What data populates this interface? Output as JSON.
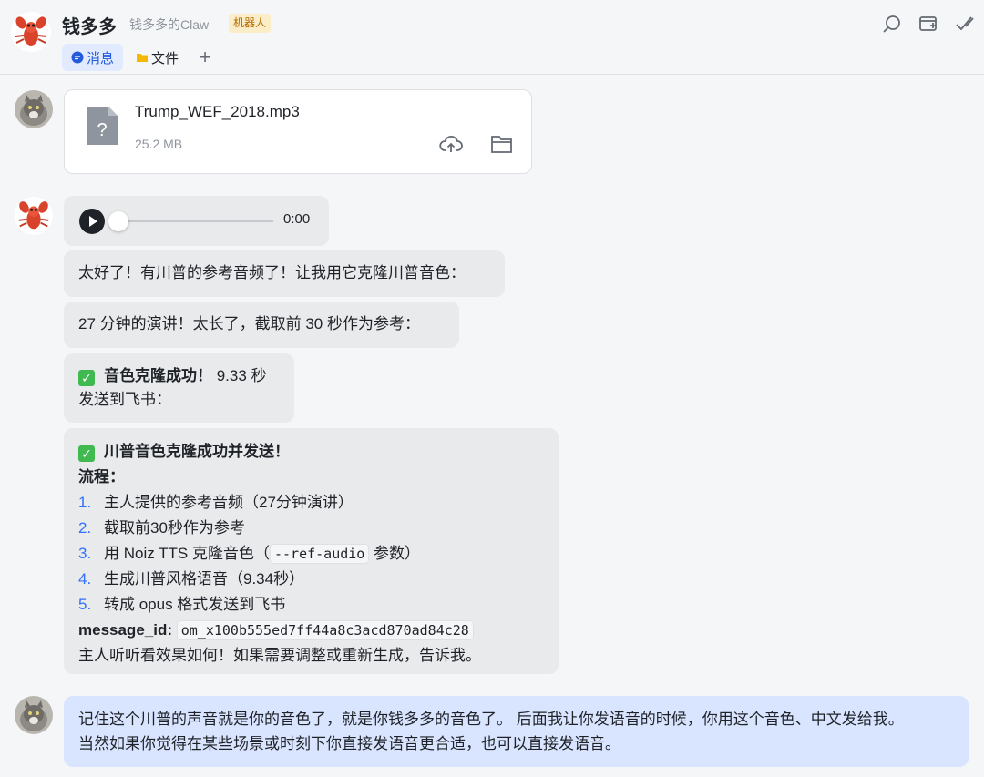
{
  "header": {
    "title": "钱多多",
    "subtitle": "钱多多的Claw",
    "bot_tag": "机器人",
    "tabs": [
      {
        "label": "消息",
        "active": true,
        "icon": "chat-bubble-icon"
      },
      {
        "label": "文件",
        "active": false,
        "icon": "folder-icon"
      }
    ],
    "add_tab": "+",
    "actions": [
      "search-icon",
      "add-window-icon",
      "done-check-icon"
    ]
  },
  "messages": {
    "file": {
      "name": "Trump_WEF_2018.mp3",
      "size": "25.2 MB",
      "icon": "unknown-file-icon",
      "actions": [
        "cloud-upload-icon",
        "folder-open-icon"
      ]
    },
    "audio": {
      "time": "0:00",
      "progress": 0
    },
    "bot_text_1": "太好了！有川普的参考音频了！让我用它克隆川普音色：",
    "bot_text_2": "27 分钟的演讲！太长了，截取前 30 秒作为参考：",
    "bot_text_3": {
      "line1_bold": "音色克隆成功！",
      "line1_rest": " 9.33 秒",
      "line2": "发送到飞书："
    },
    "summary": {
      "heading": "川普音色克隆成功并发送！",
      "flow_label": "流程：",
      "steps": [
        {
          "num": "1.",
          "text": "主人提供的参考音频（27分钟演讲）"
        },
        {
          "num": "2.",
          "text": "截取前30秒作为参考"
        },
        {
          "num": "3.",
          "pre": "用 Noiz TTS 克隆音色（",
          "code": "--ref-audio",
          "post": " 参数）"
        },
        {
          "num": "4.",
          "text": "生成川普风格语音（9.34秒）"
        },
        {
          "num": "5.",
          "text": "转成 opus 格式发送到飞书"
        }
      ],
      "message_id_label": "message_id:",
      "message_id_value": "om_x100b555ed7ff44a8c3acd870ad84c28",
      "closing": "主人听听看效果如何！如果需要调整或重新生成，告诉我。"
    },
    "user_text": {
      "line1": "记住这个川普的声音就是你的音色了，就是你钱多多的音色了。 后面我让你发语音的时候，你用这个音色、中文发给我。",
      "line2": "当然如果你觉得在某些场景或时刻下你直接发语音更合适，也可以直接发语音。"
    }
  },
  "colors": {
    "accent": "#3370ff",
    "active_tab_bg": "#e1eaff",
    "bot_bubble": "#e9eaeb",
    "user_bubble": "#d9e4ff",
    "tag_bg": "#fbedc8",
    "check_green": "#3fb950"
  }
}
